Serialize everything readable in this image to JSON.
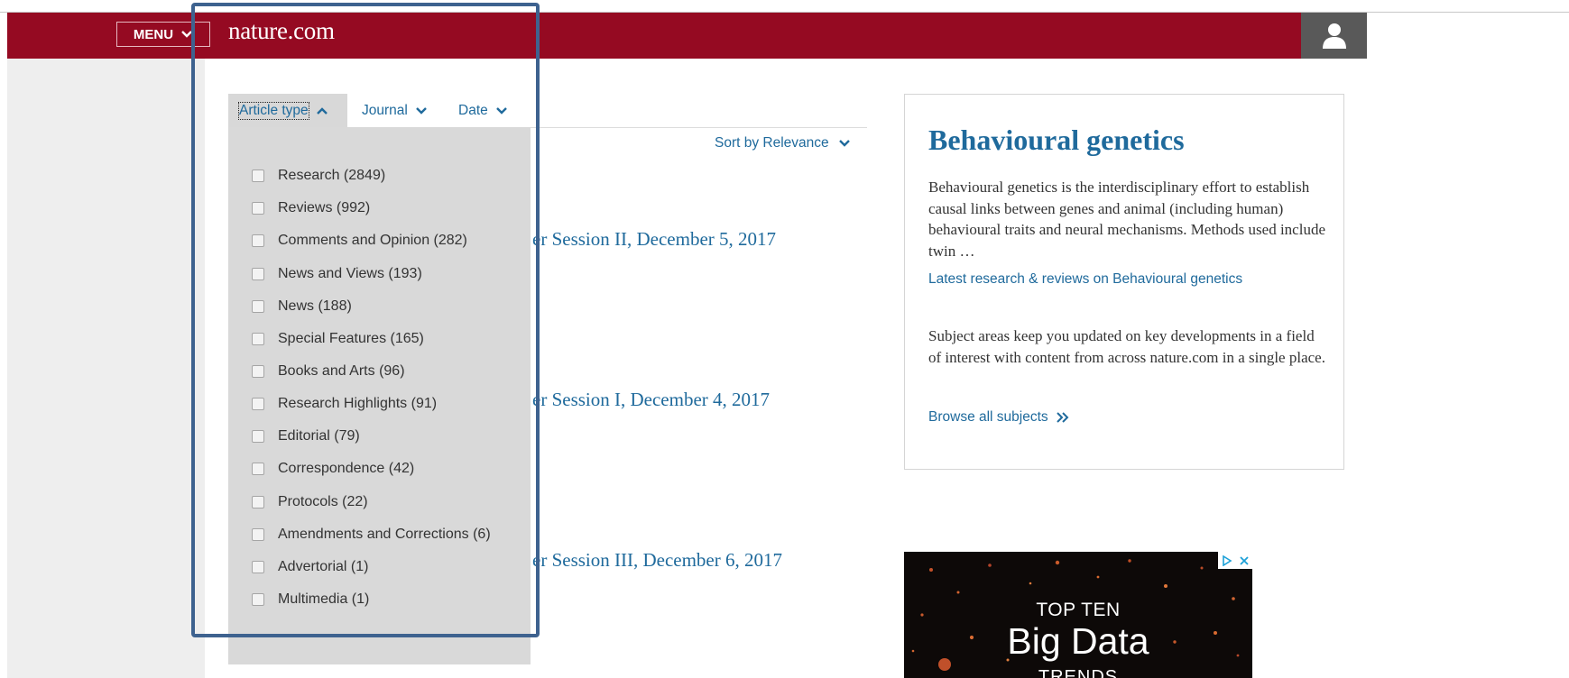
{
  "header": {
    "menu_label": "MENU",
    "logo": "nature.com",
    "colors": {
      "brand": "#950a22",
      "user_box": "#595959"
    }
  },
  "filters": {
    "tabs": [
      {
        "label": "Article type",
        "expanded": true
      },
      {
        "label": "Journal",
        "expanded": false
      },
      {
        "label": "Date",
        "expanded": false
      }
    ],
    "sort_label": "Sort by Relevance",
    "article_type_options": [
      {
        "label": "Research (2849)",
        "checked": false
      },
      {
        "label": "Reviews (992)",
        "checked": false
      },
      {
        "label": "Comments and Opinion (282)",
        "checked": false
      },
      {
        "label": "News and Views (193)",
        "checked": false
      },
      {
        "label": "News (188)",
        "checked": false
      },
      {
        "label": "Special Features (165)",
        "checked": false
      },
      {
        "label": "Books and Arts (96)",
        "checked": false
      },
      {
        "label": "Research Highlights (91)",
        "checked": false
      },
      {
        "label": "Editorial (79)",
        "checked": false
      },
      {
        "label": "Correspondence (42)",
        "checked": false
      },
      {
        "label": "Protocols (22)",
        "checked": false
      },
      {
        "label": "Amendments and Corrections (6)",
        "checked": false
      },
      {
        "label": "Advertorial (1)",
        "checked": false
      },
      {
        "label": "Multimedia (1)",
        "checked": false
      }
    ]
  },
  "articles": [
    {
      "visible_title_fragment": "er Session II, December 5, 2017"
    },
    {
      "visible_title_fragment": "er Session I, December 4, 2017"
    },
    {
      "visible_title_fragment": "er Session III, December 6, 2017"
    }
  ],
  "sidebar": {
    "title": "Behavioural genetics",
    "description": "Behavioural genetics is the interdisciplinary effort to establish causal links between genes and animal (including human) behavioural traits and neural mechanisms. Methods used include twin …",
    "latest_link": "Latest research & reviews on Behavioural genetics",
    "subject_info": "Subject areas keep you updated on key developments in a field of interest with content from across nature.com in a single place.",
    "browse_link": "Browse all subjects"
  },
  "ad": {
    "line1": "TOP TEN",
    "line2": "Big Data",
    "line3": "TRENDS"
  },
  "icons": [
    "chevron-down-icon",
    "chevron-up-icon",
    "user-icon",
    "double-chevron-right-icon",
    "adchoices-icon",
    "close-icon"
  ]
}
